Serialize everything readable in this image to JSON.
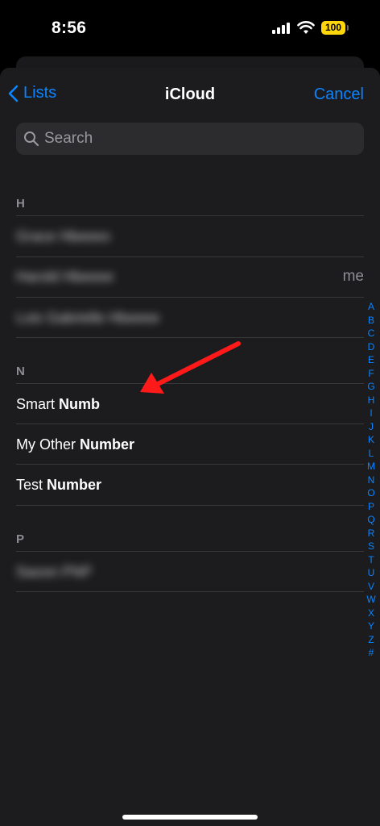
{
  "status": {
    "time": "8:56",
    "battery": "100"
  },
  "nav": {
    "back_label": "Lists",
    "title": "iCloud",
    "cancel_label": "Cancel"
  },
  "search": {
    "placeholder": "Search"
  },
  "sections": [
    {
      "letter": "H",
      "contacts": [
        {
          "name": "Grace Hbeeeo",
          "blurred": true
        },
        {
          "name": "Harold Hbeeee",
          "blurred": true,
          "tag": "me"
        },
        {
          "name": "Lois Gabrielle Hbeeee",
          "blurred": true
        }
      ]
    },
    {
      "letter": "N",
      "contacts": [
        {
          "first": "Smart",
          "last": "Numb"
        },
        {
          "first": "My Other",
          "last": "Number"
        },
        {
          "first": "Test",
          "last": "Number"
        }
      ]
    },
    {
      "letter": "P",
      "contacts": [
        {
          "name": "Saoon PNP",
          "blurred": true
        }
      ]
    }
  ],
  "index_letters": [
    "A",
    "B",
    "C",
    "D",
    "E",
    "F",
    "G",
    "H",
    "I",
    "J",
    "K",
    "L",
    "M",
    "N",
    "O",
    "P",
    "Q",
    "R",
    "S",
    "T",
    "U",
    "V",
    "W",
    "X",
    "Y",
    "Z",
    "#"
  ],
  "colors": {
    "accent": "#0a84ff",
    "arrow": "#ff1a1a",
    "battery": "#ffd60a"
  },
  "icons": {
    "back": "chevron-left-icon",
    "search": "search-icon",
    "annotation": "red-arrow-icon"
  }
}
